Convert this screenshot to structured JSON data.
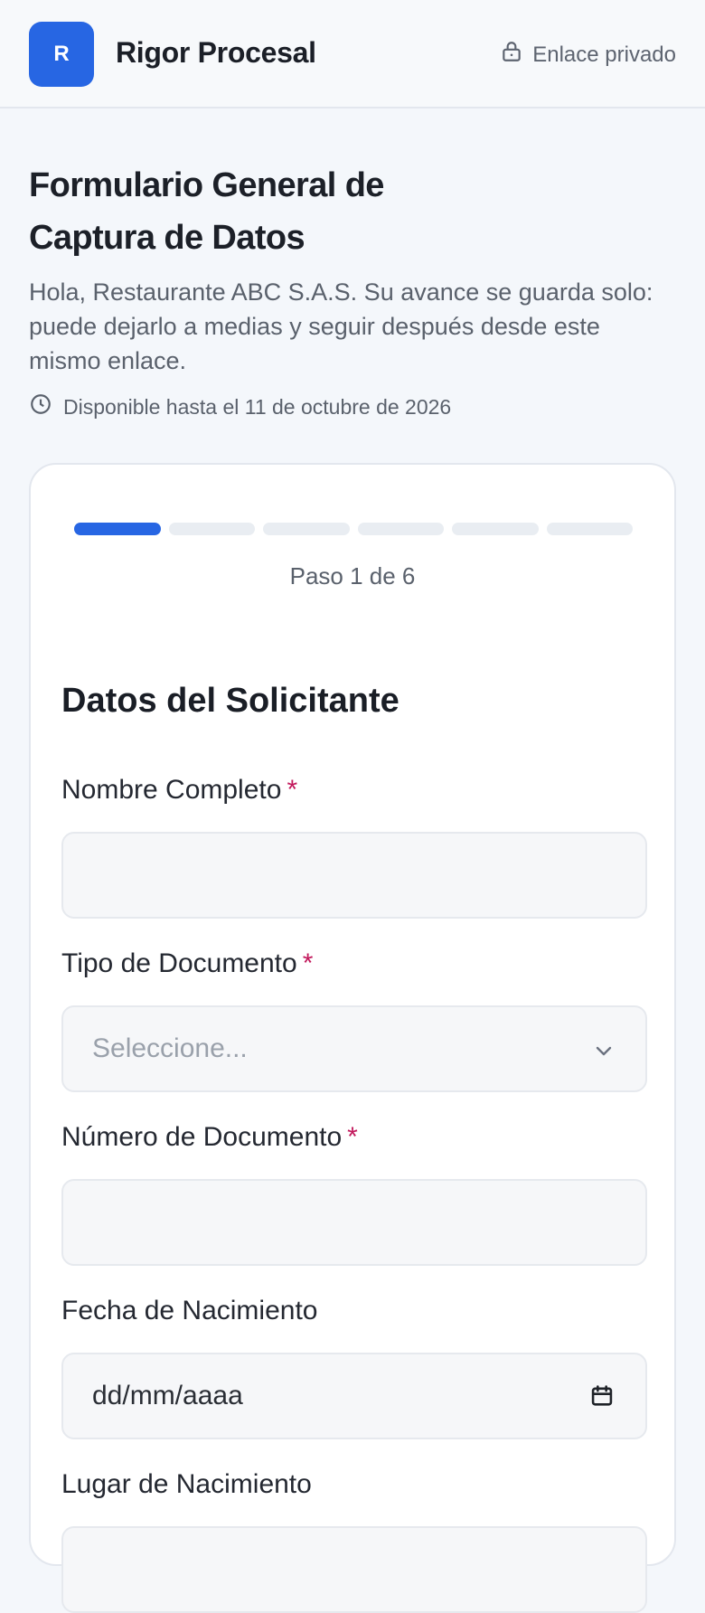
{
  "header": {
    "logo_letter": "R",
    "brand": "Rigor Procesal",
    "private_link": "Enlace privado",
    "private_icon": "lock-icon"
  },
  "intro": {
    "title": "Formulario General de Captura de Datos",
    "description": "Hola, Restaurante ABC S.A.S. Su avance se guarda solo: puede dejarlo a medias y seguir después desde este mismo enlace.",
    "deadline": "Disponible hasta el 11 de octubre de 2026",
    "deadline_icon": "clock-icon"
  },
  "progress": {
    "current": 1,
    "total": 6,
    "label": "Paso 1 de 6"
  },
  "section": {
    "title": "Datos del Solicitante",
    "required_mark": "*",
    "fields": [
      {
        "label": "Nombre Completo",
        "required": true,
        "value": ""
      },
      {
        "label": "Tipo de Documento",
        "required": true,
        "placeholder": "Seleccione..."
      },
      {
        "label": "Número de Documento",
        "required": true,
        "value": ""
      },
      {
        "label": "Fecha de Nacimiento",
        "required": false,
        "placeholder": "dd/mm/aaaa"
      },
      {
        "label": "Lugar de Nacimiento",
        "required": false,
        "value": ""
      }
    ]
  },
  "colors": {
    "accent": "#2766e3",
    "required": "#c2185b",
    "page_bg": "#f4f7fb"
  }
}
